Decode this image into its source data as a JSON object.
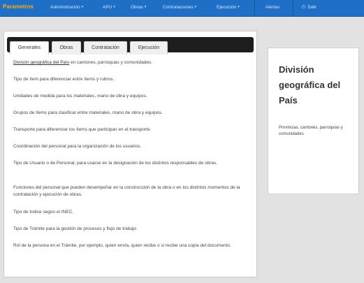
{
  "navbar": {
    "brand": "Parametros",
    "items": [
      {
        "label": "Administración",
        "caret": "▾"
      },
      {
        "label": "APU",
        "caret": "▾"
      },
      {
        "label": "Obras",
        "caret": "▾"
      },
      {
        "label": "Contrataciones",
        "caret": "▾"
      },
      {
        "label": "Ejecución",
        "caret": "▾"
      }
    ],
    "alerts": "Alertas",
    "logout_icon": "⏻",
    "logout": "Salir"
  },
  "tabs": [
    "Generales",
    "Obras",
    "Contratación",
    "Ejecución"
  ],
  "active_tab": "Generales",
  "content": {
    "p1_link": "División geográfica del País",
    "p1_rest": " en cantones, parroquias y comunidades.",
    "p2": "Tipo de ítem para diferenciar entre ítems y rubros.",
    "p3": "Unidades de medida para los materiales, mano de obra y equipos.",
    "p4": "Grupos de ítems para clasificar entre materiales, mano de obra y equipos.",
    "p5": "Transporte para diferenciar los ítems que participan en el transporte.",
    "p6": "Coordinación del personal para la organización de los usuarios.",
    "p7": "Tipo de Usuario o de Personal, para usarse en la designación de los distintos responsables de obras.",
    "p8": "Funciones del personal que pueden desempeñar en la construcción de la obra o en los distintos momentos de la contratación y ejecución de obras.",
    "p9": "Tipo de Indice según el INEC.",
    "p10": "Tipo de Trámite para la gestión de procesos y flujo de trabajo",
    "p11": "Rol de la persona en el Trámite, por ejemplo, quien envía, quien recibe o si recibe una copia del documento."
  },
  "side": {
    "title": "División geográfica del País",
    "description": "Provincias, cantones, parroquias y comunidades"
  },
  "colors": {
    "navbar": "#1f6fc6",
    "brand": "#ffa81c",
    "tabbar": "#1e1e1e",
    "background": "#e2e2e2"
  }
}
